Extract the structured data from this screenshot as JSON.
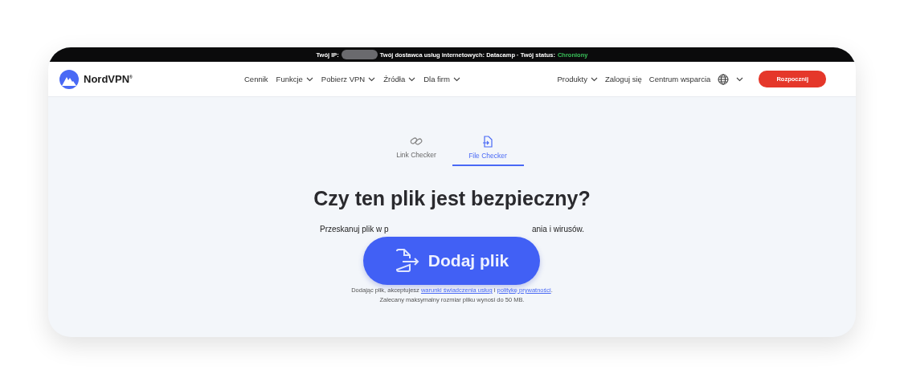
{
  "status_bar": {
    "ip_label": "Twój IP:",
    "isp_label": "Twój dostawca usług internetowych: Datacamp · Twój status:",
    "status": "Chroniony"
  },
  "nav": {
    "logo": "NordVPN",
    "logo_mark": "®",
    "items": [
      {
        "label": "Cennik",
        "dropdown": false
      },
      {
        "label": "Funkcje",
        "dropdown": true
      },
      {
        "label": "Pobierz VPN",
        "dropdown": true
      },
      {
        "label": "Źródła",
        "dropdown": true
      },
      {
        "label": "Dla firm",
        "dropdown": true
      }
    ],
    "right_items": [
      {
        "label": "Produkty",
        "dropdown": true
      },
      {
        "label": "Zaloguj się",
        "dropdown": false
      },
      {
        "label": "Centrum wsparcia",
        "dropdown": false
      }
    ],
    "cta": "Rozpocznij"
  },
  "tabs": [
    {
      "label": "Link Checker",
      "selected": false,
      "kind": "link"
    },
    {
      "label": "File Checker",
      "selected": true,
      "kind": "file"
    }
  ],
  "heading": "Czy ten plik jest bezpieczny?",
  "description_left": "Przeskanuj plik w p",
  "description_right": "ania i wirusów.",
  "add_button": "Dodaj plik",
  "terms": {
    "prefix": "Dodając plik, akceptujesz",
    "link1": "warunki świadczenia usług",
    "middle": "i",
    "link2": "politykę prywatności",
    "suffix": "."
  },
  "size_note": "Zalecany maksymalny rozmiar pliku wynosi do 50 MB."
}
